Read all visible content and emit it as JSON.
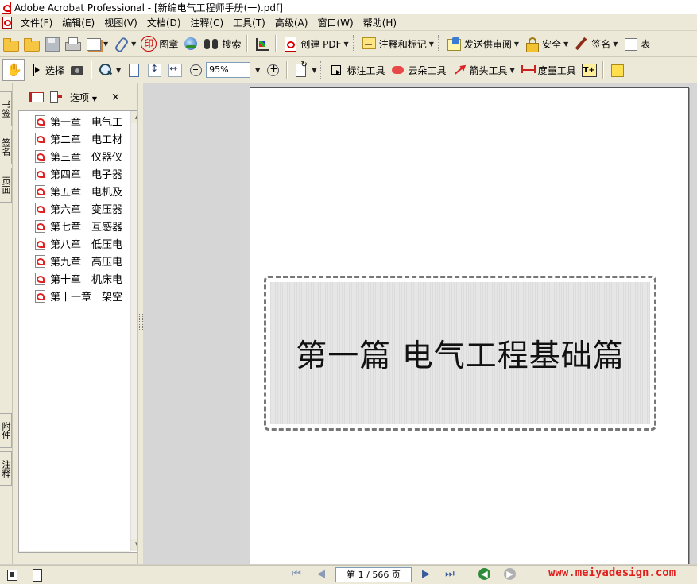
{
  "window": {
    "title": "Adobe Acrobat Professional - [新编电气工程师手册(一).pdf]"
  },
  "menu": {
    "items": [
      "文件(F)",
      "编辑(E)",
      "视图(V)",
      "文档(D)",
      "注释(C)",
      "工具(T)",
      "高级(A)",
      "窗口(W)",
      "帮助(H)"
    ]
  },
  "toolbar1": {
    "stamp_label": "图章",
    "search_label": "搜索",
    "create_pdf_label": "创建 PDF",
    "comment_markup_label": "注释和标记",
    "send_review_label": "发送供审阅",
    "secure_label": "安全",
    "sign_label": "签名",
    "overflow_label": "表"
  },
  "toolbar2": {
    "select_label": "选择",
    "zoom_value": "95%",
    "markup_tool_label": "标注工具",
    "cloud_tool_label": "云朵工具",
    "arrow_tool_label": "箭头工具",
    "measure_tool_label": "度量工具"
  },
  "nav_tabs": {
    "bookmarks": "书签",
    "signatures": "签名",
    "pages": "页面",
    "attachments": "附件",
    "comments": "注释"
  },
  "bookmarks_panel": {
    "options_label": "选项",
    "close_glyph": "×",
    "items": [
      "第一章　电气工",
      "第二章　电工材",
      "第三章　仪器仪",
      "第四章　电子器",
      "第五章　电机及",
      "第六章　变压器",
      "第七章　互感器",
      "第八章　低压电",
      "第九章　高压电",
      "第十章　机床电",
      "第十一章　架空"
    ]
  },
  "document": {
    "heading": "第一篇  电气工程基础篇"
  },
  "statusbar": {
    "page_indicator": "第 1 / 566 页",
    "watermark": "www.meiyadesign.com"
  },
  "colors": {
    "chrome": "#ece9d8",
    "doc_background": "#d6d6d6",
    "watermark": "#e0201e",
    "nav_back": "#2e8b3a",
    "nav_forward": "#b0b0b0"
  }
}
